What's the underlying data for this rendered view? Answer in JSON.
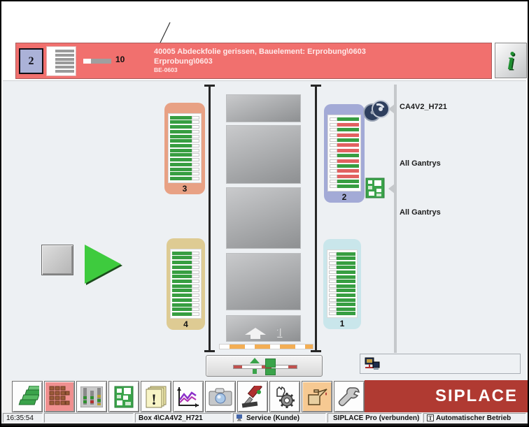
{
  "colors": {
    "alert_bg": "#f1706e",
    "alert_text": "#ffeaea",
    "station_bg": "#abb2d8",
    "bar_green": "#379e41",
    "bar_red": "#e26161",
    "brand_red": "#b03a32",
    "active_pink": "#f09090",
    "active_orange": "#f6c992",
    "start_green": "#3ecb3e"
  },
  "alert": {
    "station_number": "2",
    "progress_label": "10",
    "line1": "40005 Abdeckfolie gerissen, Bauelement: Erprobung\\0603",
    "line2": "Erprobung\\0603",
    "line3": "BE-0603",
    "info_icon_glyph": "i"
  },
  "machine": {
    "banks": [
      {
        "id": "3",
        "position": "top-left",
        "bg": "#e8a184",
        "notch": "right",
        "bars": [
          "green",
          "green",
          "green",
          "green",
          "green",
          "green",
          "green",
          "green",
          "green",
          "green",
          "green",
          "green",
          "green",
          "green"
        ]
      },
      {
        "id": "2",
        "position": "top-right",
        "bg": "#a3aad6",
        "notch": "left",
        "bars": [
          "green",
          "red",
          "green",
          "red",
          "green",
          "red",
          "red",
          "green",
          "red",
          "green",
          "red",
          "red",
          "green",
          "green"
        ]
      },
      {
        "id": "4",
        "position": "bottom-left",
        "bg": "#decb93",
        "notch": "right",
        "bars": [
          "green",
          "green",
          "green",
          "green",
          "green",
          "green",
          "green",
          "green",
          "green",
          "green",
          "green",
          "green",
          "green",
          "green"
        ]
      },
      {
        "id": "1",
        "position": "bottom-right",
        "bg": "#c9e6eb",
        "notch": "left",
        "bars": [
          "green",
          "green",
          "green",
          "green",
          "green",
          "green",
          "green",
          "green",
          "green",
          "green",
          "green",
          "green",
          "green",
          "green"
        ]
      }
    ],
    "lane_number": "1",
    "reel_label": "CA4V2_H721",
    "gantry_label_1": "All Gantrys",
    "gantry_label_2": "All Gantrys"
  },
  "toolbar": {
    "logo": "SIPLACE",
    "buttons": [
      {
        "name": "boards-stack-button",
        "active": false
      },
      {
        "name": "feeder-table-button",
        "active": "pink"
      },
      {
        "name": "component-stock-button",
        "active": false
      },
      {
        "name": "pcb-layout-button",
        "active": false
      },
      {
        "name": "error-log-button",
        "active": false
      },
      {
        "name": "statistics-button",
        "active": false
      },
      {
        "name": "camera-button",
        "active": false
      },
      {
        "name": "adjust-tools-button",
        "active": false
      },
      {
        "name": "manual-operation-button",
        "active": false
      },
      {
        "name": "maintenance-button",
        "active": "orange"
      },
      {
        "name": "service-button",
        "active": false
      }
    ]
  },
  "statusbar": {
    "time": "16:35:54",
    "box": "Box 4\\CA4V2_H721",
    "user": "Service (Kunde)",
    "connection": "SIPLACE Pro (verbunden)",
    "mode": "Automatischer Betrieb",
    "mode_icon_letter": "T"
  }
}
